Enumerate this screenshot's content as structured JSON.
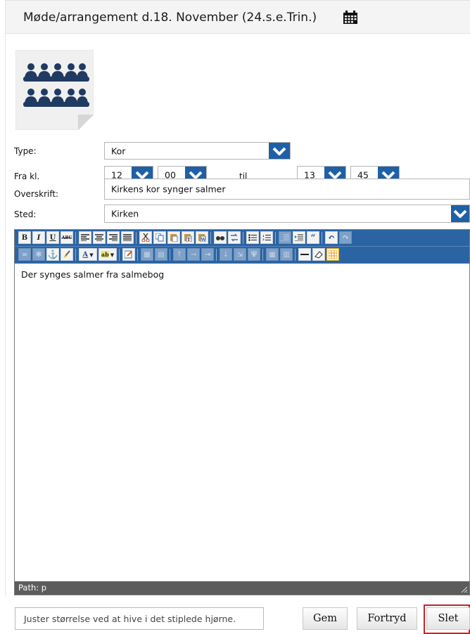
{
  "header": {
    "title": "Møde/arrangement d.18. November (24.s.e.Trin.)",
    "icon": "calendar-icon"
  },
  "image": {
    "icon": "choir-group-icon"
  },
  "form": {
    "type": {
      "label": "Type:",
      "value": "Kor"
    },
    "time": {
      "label": "Fra kl.",
      "from_hour": "12",
      "from_minute": "00",
      "to_label": "til",
      "to_hour": "13",
      "to_minute": "45"
    },
    "heading": {
      "label": "Overskrift:",
      "value": "Kirkens kor synger salmer"
    },
    "place": {
      "label": "Sted:",
      "value": "Kirken"
    }
  },
  "editor": {
    "toolbar_row1": [
      "bold",
      "italic",
      "underline",
      "strikethrough",
      "align-left",
      "align-center",
      "align-right",
      "align-justify",
      "cut",
      "copy",
      "paste",
      "paste-text",
      "paste-word",
      "find",
      "replace",
      "bullet-list",
      "numbered-list",
      "outdent",
      "indent",
      "blockquote",
      "undo",
      "redo"
    ],
    "toolbar_row2": [
      "link",
      "unlink",
      "anchor",
      "cleanup",
      "text-color",
      "highlight-color",
      "edit-html",
      "table",
      "table-props",
      "row-insert",
      "row-delete",
      "col-insert",
      "col-delete",
      "merge",
      "split",
      "cell-props",
      "horizontal-rule",
      "remove-format",
      "visual-aid"
    ],
    "labels": {
      "bold": "B",
      "italic": "I",
      "underline": "U",
      "strike": "ABC",
      "text_color": "A",
      "highlight": "ab"
    },
    "content": "Der synges salmer fra salmebog",
    "path_label": "Path: p"
  },
  "footer": {
    "hint": "Juster størrelse ved at hive i det stiplede hjørne.",
    "save_label": "Gem",
    "cancel_label": "Fortryd",
    "delete_label": "Slet"
  },
  "colors": {
    "accent": "#1f5fa6",
    "toolbar": "#2b64a3",
    "highlight_outline": "#c0262c"
  }
}
